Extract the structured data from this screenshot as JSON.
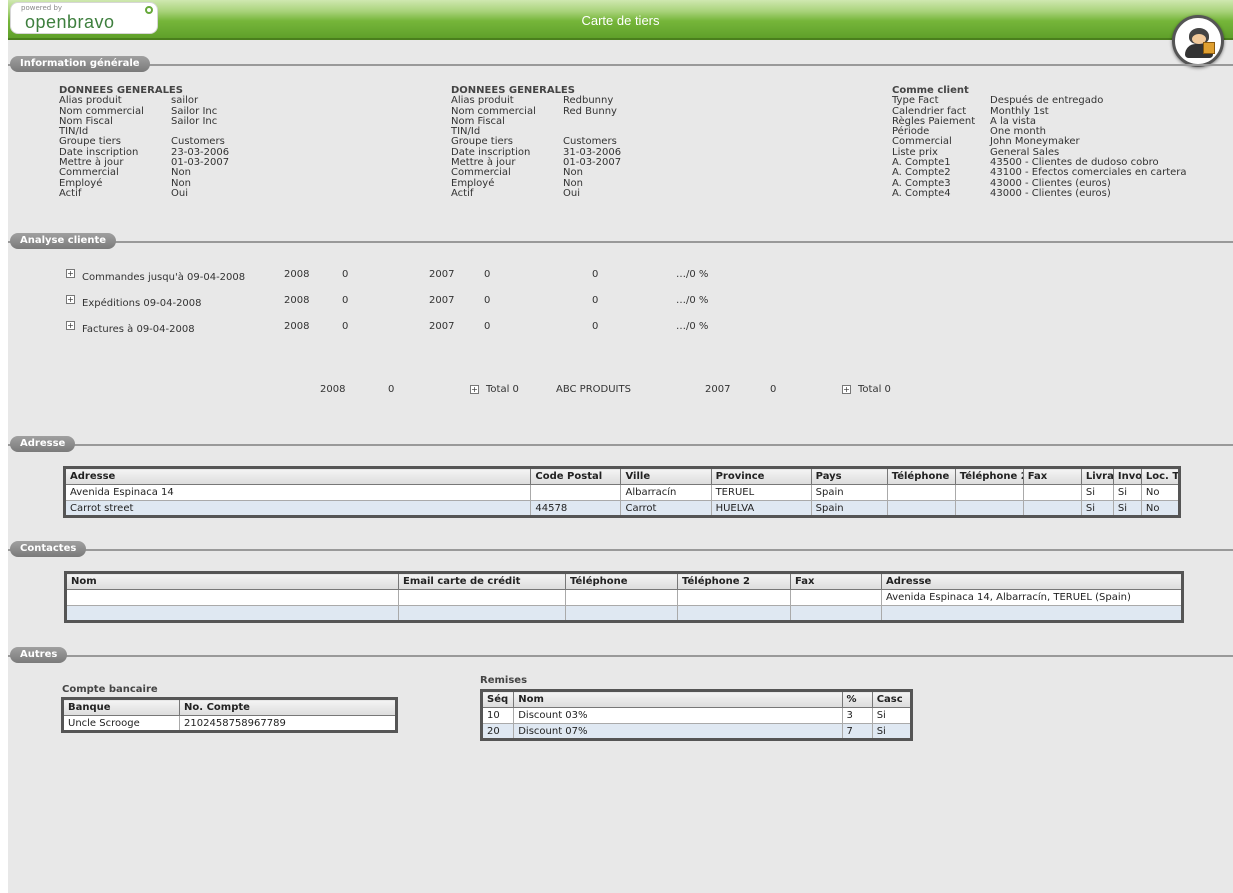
{
  "header": {
    "powered_by": "powered by",
    "brand": "openbravo",
    "title": "Carte de tiers"
  },
  "sections": {
    "general": "Information générale",
    "analysis": "Analyse cliente",
    "address": "Adresse",
    "contacts": "Contactes",
    "others": "Autres"
  },
  "general": {
    "col1": {
      "heading": "DONNEES GENERALES",
      "rows": [
        {
          "k": "Alias produit",
          "v": "sailor"
        },
        {
          "k": "Nom commercial",
          "v": "Sailor Inc"
        },
        {
          "k": "Nom Fiscal",
          "v": "Sailor Inc"
        },
        {
          "k": "TIN/Id",
          "v": ""
        },
        {
          "k": "Groupe tiers",
          "v": "Customers"
        },
        {
          "k": "Date inscription",
          "v": "23-03-2006"
        },
        {
          "k": "Mettre à jour",
          "v": "01-03-2007"
        },
        {
          "k": "Commercial",
          "v": "Non"
        },
        {
          "k": "Employé",
          "v": "Non"
        },
        {
          "k": "Actif",
          "v": "Oui"
        }
      ]
    },
    "col2": {
      "heading": "DONNEES GENERALES",
      "rows": [
        {
          "k": "Alias produit",
          "v": "Redbunny"
        },
        {
          "k": "Nom commercial",
          "v": "Red Bunny"
        },
        {
          "k": "Nom Fiscal",
          "v": ""
        },
        {
          "k": "TIN/Id",
          "v": ""
        },
        {
          "k": "Groupe tiers",
          "v": "Customers"
        },
        {
          "k": "Date inscription",
          "v": "31-03-2006"
        },
        {
          "k": "Mettre à jour",
          "v": "01-03-2007"
        },
        {
          "k": "Commercial",
          "v": "Non"
        },
        {
          "k": "Employé",
          "v": "Non"
        },
        {
          "k": "Actif",
          "v": "Oui"
        }
      ]
    },
    "col3": {
      "heading": "Comme client",
      "rows": [
        {
          "k": "Type Fact",
          "v": "Después de entregado"
        },
        {
          "k": "Calendrier fact",
          "v": "Monthly 1st"
        },
        {
          "k": "Règles Paiement",
          "v": "A la vista"
        },
        {
          "k": "Période",
          "v": "One month"
        },
        {
          "k": "Commercial",
          "v": "John Moneymaker"
        },
        {
          "k": "Liste prix",
          "v": "General Sales"
        },
        {
          "k": "A. Compte1",
          "v": "43500 - Clientes de dudoso cobro"
        },
        {
          "k": "A. Compte2",
          "v": "43100 - Efectos comerciales en cartera"
        },
        {
          "k": "A. Compte3",
          "v": "43000 - Clientes (euros)"
        },
        {
          "k": "A. Compte4",
          "v": "43000 - Clientes (euros)"
        }
      ]
    }
  },
  "analysis": {
    "rows": [
      {
        "label": "Commandes jusqu'à 09-04-2008",
        "y1": "2008",
        "v1": "0",
        "y2": "2007",
        "v2": "0",
        "v3": "0",
        "pct": "…/0 %"
      },
      {
        "label": "Expéditions 09-04-2008",
        "y1": "2008",
        "v1": "0",
        "y2": "2007",
        "v2": "0",
        "v3": "0",
        "pct": "…/0 %"
      },
      {
        "label": "Factures à 09-04-2008",
        "y1": "2008",
        "v1": "0",
        "y2": "2007",
        "v2": "0",
        "v3": "0",
        "pct": "…/0 %"
      }
    ],
    "totals": {
      "y1": "2008",
      "v1": "0",
      "total1": "Total 0",
      "product": "ABC PRODUITS",
      "y2": "2007",
      "v2": "0",
      "total2": "Total 0"
    }
  },
  "address_table": {
    "columns": [
      "Adresse",
      "Code Postal",
      "Ville",
      "Province",
      "Pays",
      "Téléphone",
      "Téléphone 2",
      "Fax",
      "Livraison",
      "Invoice",
      "Loc. Taxe"
    ],
    "rows": [
      [
        "Avenida Espinaca 14",
        "",
        "Albarracín",
        "TERUEL",
        "Spain",
        "",
        "",
        "",
        "Si",
        "Si",
        "No"
      ],
      [
        "Carrot street",
        "44578",
        "Carrot",
        "HUELVA",
        "Spain",
        "",
        "",
        "",
        "Si",
        "Si",
        "No"
      ]
    ]
  },
  "contacts_table": {
    "columns": [
      "Nom",
      "Email carte de crédit",
      "Téléphone",
      "Téléphone 2",
      "Fax",
      "Adresse"
    ],
    "rows": [
      [
        "",
        "",
        "",
        "",
        "",
        "Avenida Espinaca 14, Albarracín, TERUEL (Spain)"
      ],
      [
        "",
        "",
        "",
        "",
        "",
        ""
      ]
    ]
  },
  "bank": {
    "label": "Compte bancaire",
    "columns": [
      "Banque",
      "No. Compte"
    ],
    "rows": [
      [
        "Uncle Scrooge",
        "2102458758967789"
      ]
    ]
  },
  "discounts": {
    "label": "Remises",
    "columns": [
      "Séq",
      "Nom",
      "%",
      "Casc"
    ],
    "rows": [
      [
        "10",
        "Discount 03%",
        "3",
        "Si"
      ],
      [
        "20",
        "Discount 07%",
        "7",
        "Si"
      ]
    ]
  }
}
